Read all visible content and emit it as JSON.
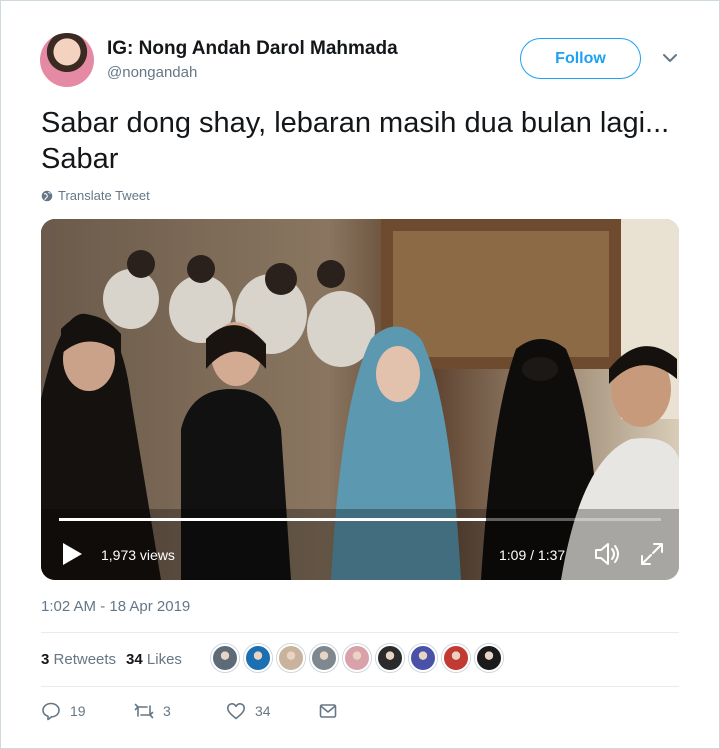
{
  "author": {
    "display_name": "IG: Nong Andah Darol Mahmada",
    "handle": "@nongandah"
  },
  "follow_label": "Follow",
  "tweet": {
    "text": "Sabar dong shay, lebaran masih dua bulan lagi...  Sabar",
    "translate_label": "Translate Tweet",
    "timestamp": "1:02 AM - 18 Apr 2019"
  },
  "video": {
    "views": "1,973 views",
    "time": "1:09 / 1:37",
    "progress_fraction": 0.71
  },
  "stats": {
    "retweets_count": "3",
    "retweets_label": "Retweets",
    "likes_count": "34",
    "likes_label": "Likes"
  },
  "actions": {
    "replies": "19",
    "retweets": "3",
    "likes": "34"
  },
  "colors": {
    "accent": "#1da1f2",
    "secondary_text": "#657786",
    "border": "#e6ecf0"
  },
  "liker_colors": [
    "#5d6a78",
    "#1c6fb0",
    "#c9b39c",
    "#7f8790",
    "#d9a1a9",
    "#2b2b2b",
    "#4a52a8",
    "#c23b33",
    "#1b1b1b"
  ]
}
